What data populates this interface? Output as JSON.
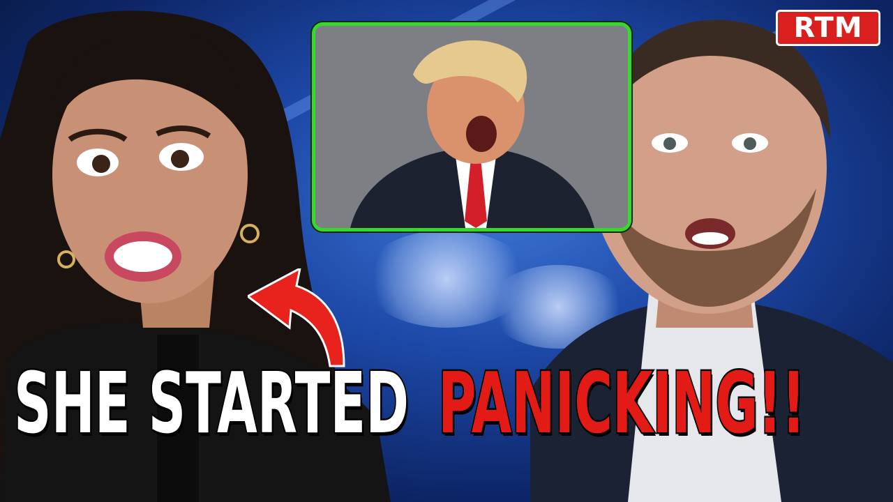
{
  "logo": {
    "text": "RTM",
    "background": "#d9201f"
  },
  "caption": {
    "part_white": "SHE STARTED",
    "part_red": "PANICKING!!",
    "white_color": "#ffffff",
    "red_color": "#e31b17"
  },
  "inset": {
    "border_color": "#39d62f"
  },
  "arrow": {
    "color": "#e8231e"
  },
  "icons": [
    "red-curved-arrow-icon"
  ]
}
